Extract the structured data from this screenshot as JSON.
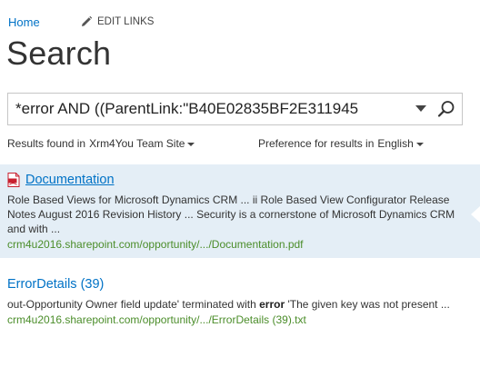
{
  "nav": {
    "home_label": "Home",
    "edit_links_label": "EDIT LINKS",
    "edit_icon": "pencil-icon"
  },
  "page": {
    "title": "Search"
  },
  "search": {
    "query": "*error AND ((ParentLink:\"B40E02835BF2E311945",
    "dropdown_icon": "chevron-down-icon",
    "search_icon": "search-icon"
  },
  "refiners": {
    "results_found_label": "Results found in",
    "site_value": "Xrm4You Team Site",
    "preference_label": "Preference for results in",
    "language_value": "English"
  },
  "results": [
    {
      "icon": "pdf-file-icon",
      "title": "Documentation",
      "summary": "Role Based Views for Microsoft Dynamics CRM ... ii Role Based View Configurator Release Notes August 2016 Revision History ... Security is a cornerstone of Microsoft Dynamics CRM and with ...",
      "url": "crm4u2016.sharepoint.com/opportunity/.../Documentation.pdf",
      "selected": true
    },
    {
      "title": "ErrorDetails (39)",
      "summary_before": "out-Opportunity Owner field update' terminated with ",
      "summary_highlight": "error",
      "summary_after": " 'The given key was not present ...",
      "url": "crm4u2016.sharepoint.com/opportunity/.../ErrorDetails (39).txt",
      "selected": false
    }
  ],
  "colors": {
    "link": "#0072c6",
    "url_green": "#4b8d2a",
    "selected_bg": "#e4eef6",
    "pdf_red": "#c8202f"
  }
}
